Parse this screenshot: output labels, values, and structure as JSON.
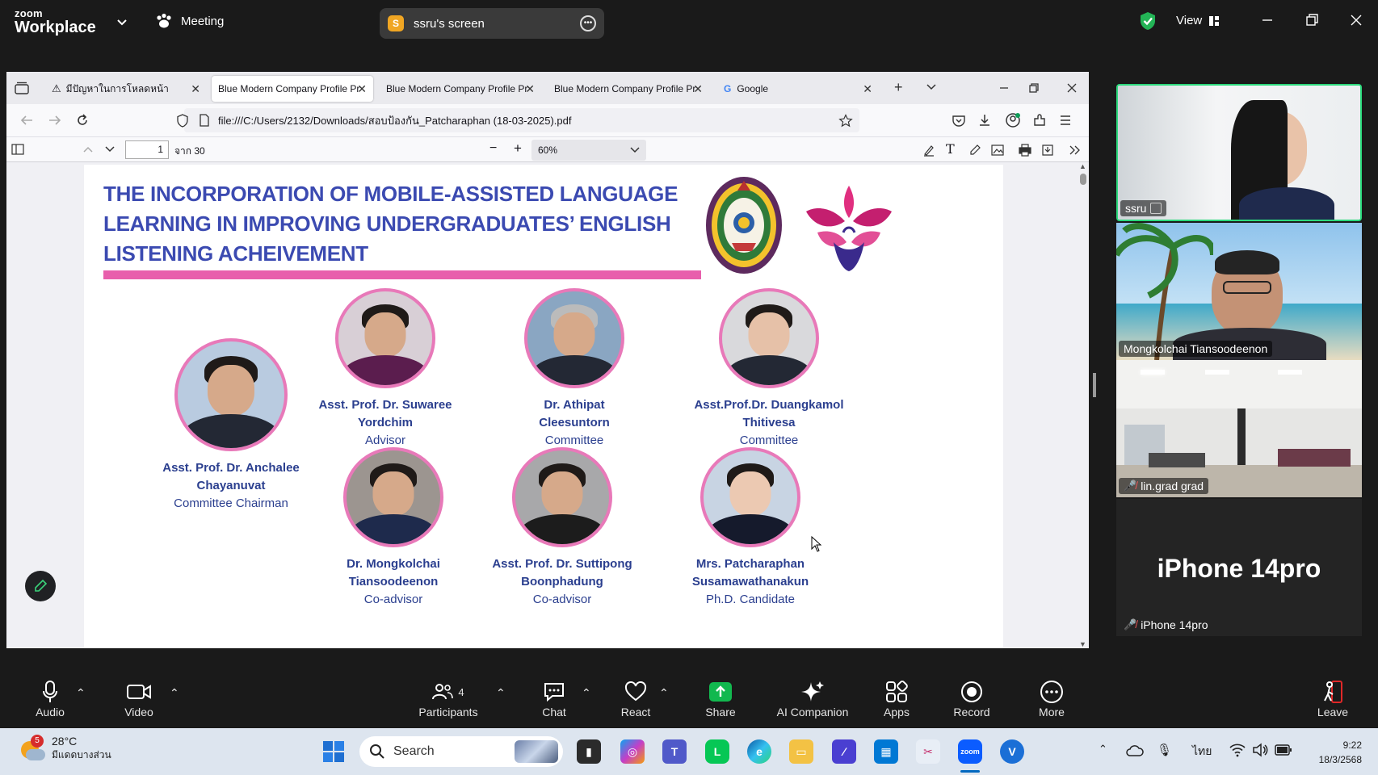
{
  "zoom": {
    "brand_small": "zoom",
    "brand_big": "Workplace",
    "meeting_label": "Meeting",
    "screen_initial": "S",
    "screen_label": "ssru's screen",
    "view_label": "View"
  },
  "browser": {
    "tabs": [
      {
        "label": "มีปัญหาในการโหลดหน้า"
      },
      {
        "label": "Blue Modern Company Profile Pr"
      },
      {
        "label": "Blue Modern Company Profile Pr"
      },
      {
        "label": "Blue Modern Company Profile Pr"
      },
      {
        "label": "Google"
      }
    ],
    "url": "file:///C:/Users/2132/Downloads/สอบป้องกัน_Patcharaphan (18-03-2025).pdf",
    "page_number": "1",
    "page_total": "จาก 30",
    "zoom_level": "60%"
  },
  "slide": {
    "title_lines": [
      "THE INCORPORATION OF MOBILE-ASSISTED LANGUAGE",
      "LEARNING IN IMPROVING UNDERGRADUATES’ ENGLISH",
      "LISTENING ACHEIVEMENT"
    ],
    "people": [
      {
        "name1": "Asst. Prof. Dr. Anchalee",
        "name2": "Chayanuvat",
        "role": "Committee Chairman"
      },
      {
        "name1": "Asst. Prof. Dr. Suwaree",
        "name2": "Yordchim",
        "role": "Advisor"
      },
      {
        "name1": "Dr. Athipat",
        "name2": "Cleesuntorn",
        "role": "Committee"
      },
      {
        "name1": "Asst.Prof.Dr. Duangkamol",
        "name2": "Thitivesa",
        "role": "Committee"
      },
      {
        "name1": "Dr. Mongkolchai",
        "name2": "Tiansoodeenon",
        "role": "Co-advisor"
      },
      {
        "name1": "Asst. Prof. Dr. Suttipong",
        "name2": "Boonphadung",
        "role": "Co-advisor"
      },
      {
        "name1": "Mrs. Patcharaphan",
        "name2": "Susamawathanakun",
        "role": "Ph.D. Candidate"
      }
    ]
  },
  "gallery": {
    "tiles": [
      {
        "name": "ssru"
      },
      {
        "name": "Mongkolchai Tiansoodeenon"
      },
      {
        "name": "lin.grad grad"
      },
      {
        "name": "iPhone 14pro",
        "display": "iPhone 14pro"
      }
    ]
  },
  "toolbar": {
    "audio": "Audio",
    "video": "Video",
    "participants": "Participants",
    "participants_count": "4",
    "chat": "Chat",
    "react": "React",
    "share": "Share",
    "ai": "AI Companion",
    "apps": "Apps",
    "record": "Record",
    "more": "More",
    "leave": "Leave"
  },
  "taskbar": {
    "temp": "28°C",
    "weather_desc": "มีแดดบางส่วน",
    "weather_badge": "5",
    "search_placeholder": "Search",
    "lang": "ไทย",
    "time": "9:22",
    "date": "18/3/2568"
  },
  "colors": {
    "slide_title": "#3b4ab1",
    "pink_bar": "#e85fac",
    "name_text": "#2b3f8f",
    "share_green": "#12b84f",
    "active_speaker": "#2bd97c"
  }
}
